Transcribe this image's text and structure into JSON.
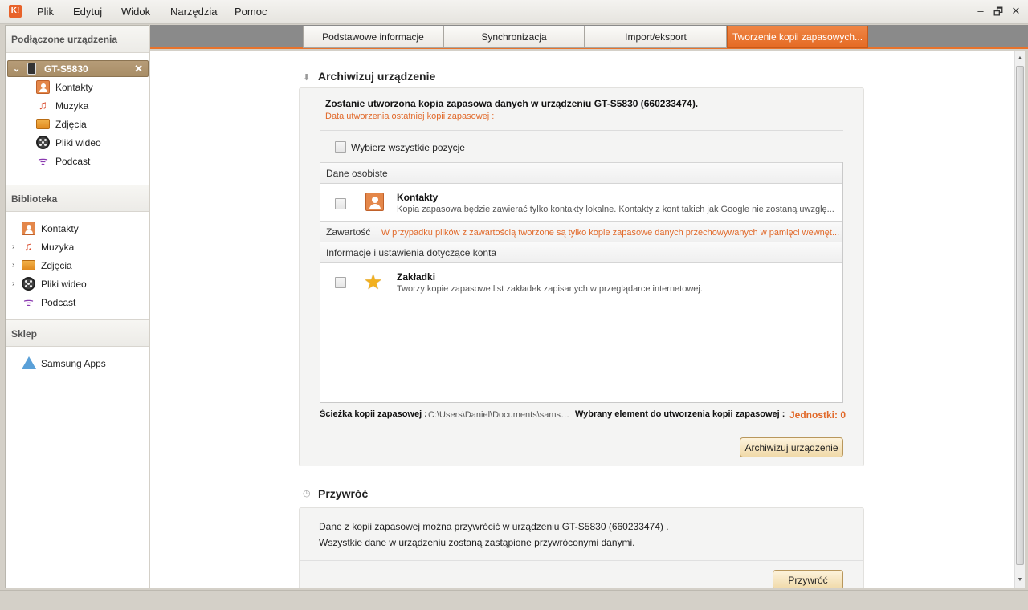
{
  "app": {
    "logo_text": "K!",
    "menu": [
      "Plik",
      "Edytuj",
      "Widok",
      "Narzędzia",
      "Pomoc"
    ],
    "window_controls": [
      "–",
      "🗗",
      "✕"
    ]
  },
  "sidebar": {
    "connected_header": "Podłączone urządzenia",
    "device": {
      "name": "GT-S5830",
      "expand_icon": "⌄",
      "close": "✕"
    },
    "device_items": [
      {
        "label": "Kontakty",
        "icon": "contacts-icon"
      },
      {
        "label": "Muzyka",
        "icon": "music-icon",
        "glyph": "♫"
      },
      {
        "label": "Zdjęcia",
        "icon": "photos-icon"
      },
      {
        "label": "Pliki wideo",
        "icon": "video-icon"
      },
      {
        "label": "Podcast",
        "icon": "podcast-icon",
        "glyph": "ᯤ"
      }
    ],
    "library_header": "Biblioteka",
    "library_items": [
      {
        "label": "Kontakty",
        "icon": "contacts-icon",
        "expandable": false
      },
      {
        "label": "Muzyka",
        "icon": "music-icon",
        "glyph": "♫",
        "expandable": true
      },
      {
        "label": "Zdjęcia",
        "icon": "photos-icon",
        "expandable": true
      },
      {
        "label": "Pliki wideo",
        "icon": "video-icon",
        "expandable": true
      },
      {
        "label": "Podcast",
        "icon": "podcast-icon",
        "glyph": "ᯤ",
        "expandable": false
      }
    ],
    "shop_header": "Sklep",
    "shop_items": [
      {
        "label": "Samsung Apps",
        "icon": "samsung-apps-icon"
      }
    ],
    "expander_glyph": "›"
  },
  "tabs": [
    {
      "label": "Podstawowe informacje",
      "active": false
    },
    {
      "label": "Synchronizacja",
      "active": false
    },
    {
      "label": "Import/eksport",
      "active": false
    },
    {
      "label": "Tworzenie kopii zapasowych...",
      "active": true
    }
  ],
  "backup": {
    "title": "Archiwizuj urządzenie",
    "intro": "Zostanie utworzona kopia zapasowa danych w urządzeniu GT-S5830 (660233474).",
    "last_backup_label": "Data utworzenia ostatniej kopii zapasowej :",
    "select_all": "Wybierz wszystkie pozycje",
    "groups": {
      "personal": "Dane osobiste",
      "content_label": "Zawartość",
      "content_note": "W przypadku plików z zawartością tworzone są tylko kopie zapasowe danych przechowywanych w pamięci wewnęt...",
      "account": "Informacje i ustawienia dotyczące konta"
    },
    "items": {
      "contacts_title": "Kontakty",
      "contacts_desc": "Kopia zapasowa będzie zawierać tylko kontakty lokalne. Kontakty z kont takich jak Google nie zostaną uwzglę...",
      "bookmarks_title": "Zakładki",
      "bookmarks_desc": "Tworzy kopie zapasowe list zakładek zapisanych w przeglądarce internetowej.",
      "star_glyph": "★"
    },
    "path_label": "Ścieżka kopii zapasowej :",
    "path_value": "C:\\Users\\Daniel\\Documents\\samsu...",
    "selected_label": "Wybrany element do utworzenia kopii zapasowej :",
    "units": "Jednostki: 0",
    "button": "Archiwizuj urządzenie",
    "icon_glyph": "⬇"
  },
  "restore": {
    "title": "Przywróć",
    "line1": "Dane z kopii zapasowej można przywrócić w urządzeniu GT-S5830 (660233474) .",
    "line2": "Wszystkie dane w urządzeniu zostaną zastąpione przywróconymi danymi.",
    "button": "Przywróć",
    "icon_glyph": "◷"
  },
  "scrollbar": {
    "up": "▲",
    "down": "▼"
  }
}
